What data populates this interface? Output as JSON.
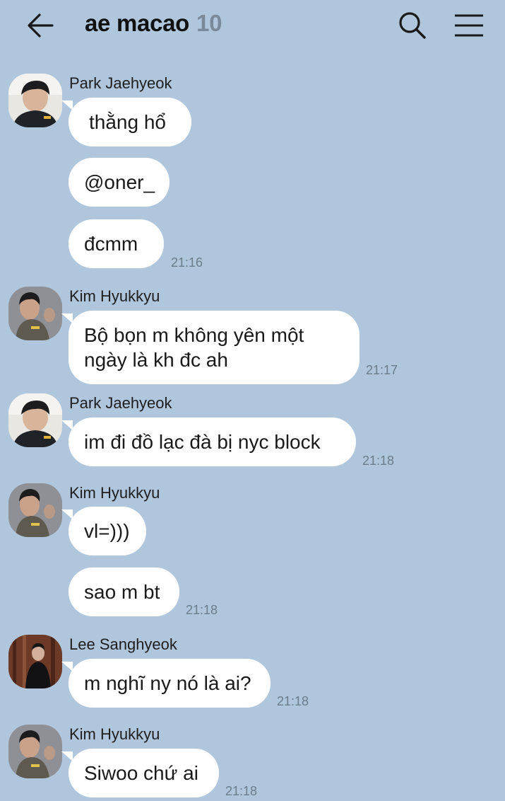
{
  "header": {
    "title": "ae macao",
    "member_count": "10",
    "icons": {
      "back": "back-arrow-icon",
      "search": "search-icon",
      "menu": "hamburger-menu-icon"
    }
  },
  "colors": {
    "background": "#b0c6dc",
    "bubble": "#ffffff"
  },
  "messages": [
    {
      "sender": "Park Jaehyeok",
      "avatar": "park",
      "bubbles": [
        "thằng hổ",
        "@oner_",
        "đcmm"
      ],
      "time": "21:16"
    },
    {
      "sender": "Kim Hyukkyu",
      "avatar": "kim",
      "bubbles": [
        "Bộ bọn m không yên một\nngày là kh đc ah"
      ],
      "time": "21:17"
    },
    {
      "sender": "Park Jaehyeok",
      "avatar": "park",
      "bubbles": [
        "im đi đồ lạc đà bị nyc block"
      ],
      "time": "21:18"
    },
    {
      "sender": "Kim Hyukkyu",
      "avatar": "kim",
      "bubbles": [
        "vl=)))",
        "sao m bt"
      ],
      "time": "21:18"
    },
    {
      "sender": "Lee Sanghyeok",
      "avatar": "lee",
      "bubbles": [
        "m nghĩ ny nó là ai?"
      ],
      "time": "21:18"
    },
    {
      "sender": "Kim Hyukkyu",
      "avatar": "kim",
      "bubbles": [
        "Siwoo chứ ai"
      ],
      "time": "21:18"
    }
  ]
}
